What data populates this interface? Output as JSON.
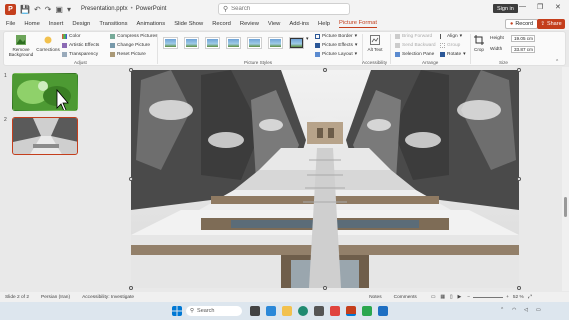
{
  "titlebar": {
    "app_icon": "P",
    "doc_title": "Presentation.pptx",
    "app_name": "PowerPoint",
    "search_placeholder": "Search",
    "signin_label": "Sign in",
    "minimize": "—",
    "restore": "❐",
    "close": "✕"
  },
  "tabs": {
    "items": [
      "File",
      "Home",
      "Insert",
      "Design",
      "Transitions",
      "Animations",
      "Slide Show",
      "Record",
      "Review",
      "View",
      "Add-ins",
      "Help",
      "Picture Format"
    ],
    "active": "Picture Format",
    "record_label": "Record",
    "share_label": "Share"
  },
  "ribbon": {
    "adjust": {
      "remove_bg": "Remove Background",
      "corrections": "Corrections",
      "color": "Color",
      "artistic": "Artistic Effects",
      "transparency": "Transparency",
      "compress": "Compress Pictures",
      "change": "Change Picture",
      "reset": "Reset Picture",
      "label": "Adjust"
    },
    "styles": {
      "label": "Picture Styles",
      "count": 7
    },
    "picture_options": {
      "border": "Picture Border",
      "effects": "Picture Effects",
      "layout": "Picture Layout"
    },
    "accessibility": {
      "alt_text": "Alt Text",
      "label": "Accessibility"
    },
    "arrange": {
      "bring_forward": "Bring Forward",
      "send_backward": "Send Backward",
      "selection_pane": "Selection Pane",
      "align": "Align",
      "group": "Group",
      "rotate": "Rotate",
      "label": "Arrange"
    },
    "size": {
      "crop": "Crop",
      "height_label": "Height",
      "height_value": "19.05 cm",
      "width_label": "Width",
      "width_value": "33.87 cm",
      "label": "Size"
    }
  },
  "slides": {
    "numbers": [
      "1",
      "2"
    ],
    "selected": 2
  },
  "statusbar": {
    "slide_info": "Slide 2 of 2",
    "language": "Persian (Iran)",
    "accessibility": "Accessibility: Investigate",
    "notes": "Notes",
    "comments": "Comments",
    "zoom": "52 %"
  },
  "taskbar": {
    "search_label": "Search"
  },
  "colors": {
    "accent": "#c43e1c",
    "taskbar": "#dde6ee"
  }
}
